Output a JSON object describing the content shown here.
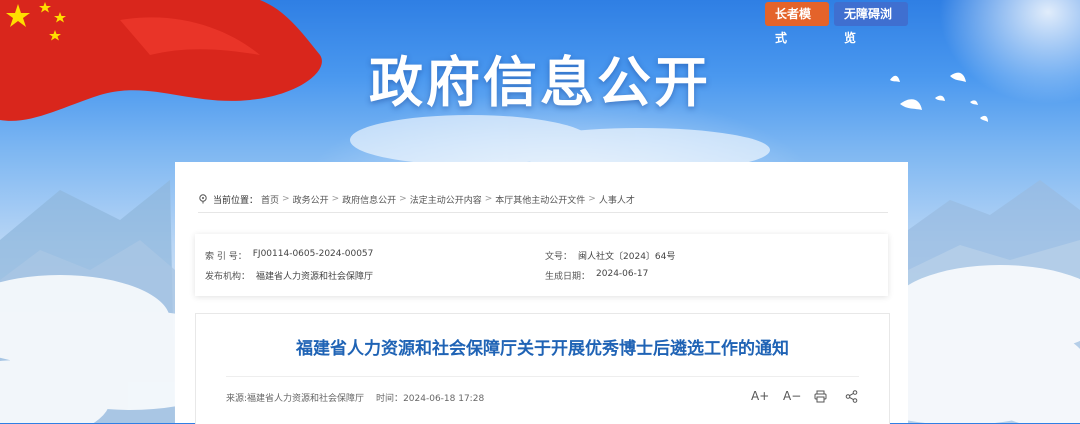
{
  "header": {
    "title": "政府信息公开",
    "elder_mode_label": "长者模式",
    "accessible_label": "无障碍浏览"
  },
  "breadcrumb": {
    "current_label": "当前位置：",
    "items": [
      "首页",
      "政务公开",
      "政府信息公开",
      "法定主动公开内容",
      "本厅其他主动公开文件",
      "人事人才"
    ],
    "separator": ">"
  },
  "meta": {
    "index_key": "索 引 号：",
    "index_value": "FJ00114-0605-2024-00057",
    "doc_no_key": "文号：",
    "doc_no_value": "闽人社文〔2024〕64号",
    "publisher_key": "发布机构：",
    "publisher_value": "福建省人力资源和社会保障厅",
    "created_key": "生成日期：",
    "created_value": "2024-06-17"
  },
  "article": {
    "title": "福建省人力资源和社会保障厅关于开展优秀博士后遴选工作的通知",
    "source_label": "来源:福建省人力资源和社会保障厅",
    "time_label": "时间：",
    "time_value": "2024-06-18 17:28",
    "font_up": "A+",
    "font_down": "A−"
  },
  "colors": {
    "accent_blue": "#1f63b5",
    "elder_btn": "#e4632a",
    "access_btn": "#3f6fd0"
  }
}
